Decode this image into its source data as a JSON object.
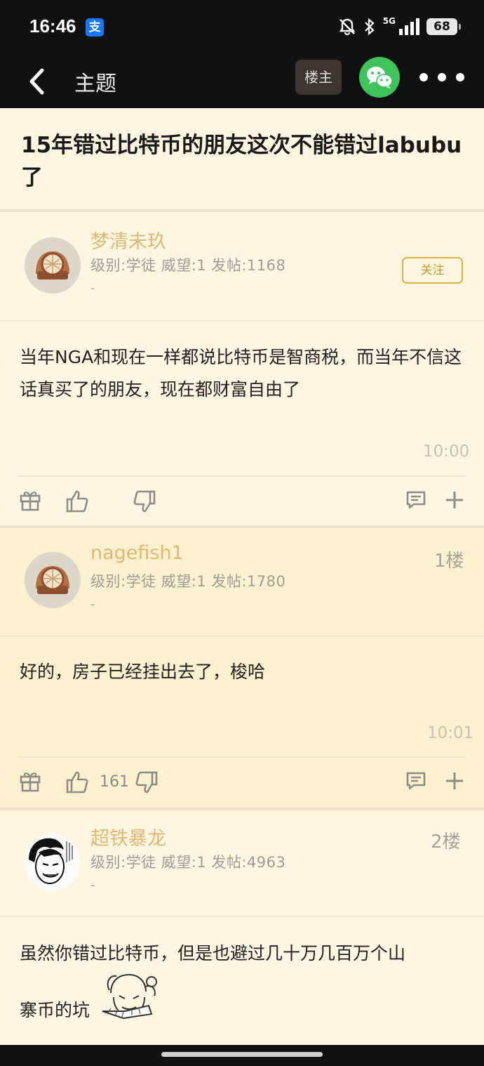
{
  "status_bar": {
    "time": "16:46",
    "app_badge": "支",
    "network": "5G",
    "battery": "68"
  },
  "nav": {
    "title": "主题",
    "op_label": "楼主",
    "wechat_icon": "wechat-icon",
    "more_icon": "more-icon"
  },
  "topic": {
    "title": "15年错过比特币的朋友这次不能错过labubu了"
  },
  "posts": [
    {
      "username": "梦清未玖",
      "info": "级别:学徒 威望:1 发帖:1168",
      "dash": "-",
      "follow_label": "关注",
      "content": "当年NGA和现在一样都说比特币是智商税，而当年不信这话真买了的朋友，现在都财富自由了",
      "time": "10:00"
    },
    {
      "username": "nagefish1",
      "info": "级别:学徒 威望:1 发帖:1780",
      "dash": "-",
      "floor": "1楼",
      "content": "好的，房子已经挂出去了，梭哈",
      "time": "10:01",
      "likes": "161"
    },
    {
      "username": "超铁暴龙",
      "info": "级别:学徒 威望:1 发帖:4963",
      "dash": "-",
      "floor": "2楼",
      "content_line1": "虽然你错过比特币，但是也避过几十万几百万个山",
      "content_line2": "寨币的坑"
    }
  ],
  "colors": {
    "username": "#e1b873",
    "alt_background": "#fcf1cf",
    "background": "#fdf7e1",
    "wechat": "#3ec35b"
  }
}
